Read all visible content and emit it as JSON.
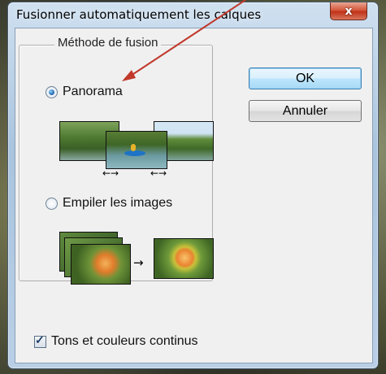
{
  "window": {
    "title": "Fusionner automatiquement les calques",
    "close_label": "x"
  },
  "fusion_method": {
    "legend": "Méthode de fusion",
    "options": [
      {
        "label": "Panorama",
        "checked": true
      },
      {
        "label": "Empiler les images",
        "checked": false
      }
    ]
  },
  "buttons": {
    "ok_label": "OK",
    "cancel_label": "Annuler"
  },
  "continuous_tones": {
    "label": "Tons et couleurs continus",
    "checked": true
  },
  "illustrations": {
    "panorama": {
      "arrow_symbol": "←→"
    },
    "stack": {
      "arrow_symbol": "→"
    }
  },
  "colors": {
    "annotation_arrow": "#c0392b",
    "title_bar": "#a9c4de",
    "close_button": "#c0321a",
    "dialog_bg": "#f0f0f0"
  },
  "icons": [
    "close-icon",
    "radio-checked-icon",
    "radio-unchecked-icon",
    "checkbox-checked-icon",
    "arrow-right-icon",
    "double-arrow-icon"
  ]
}
